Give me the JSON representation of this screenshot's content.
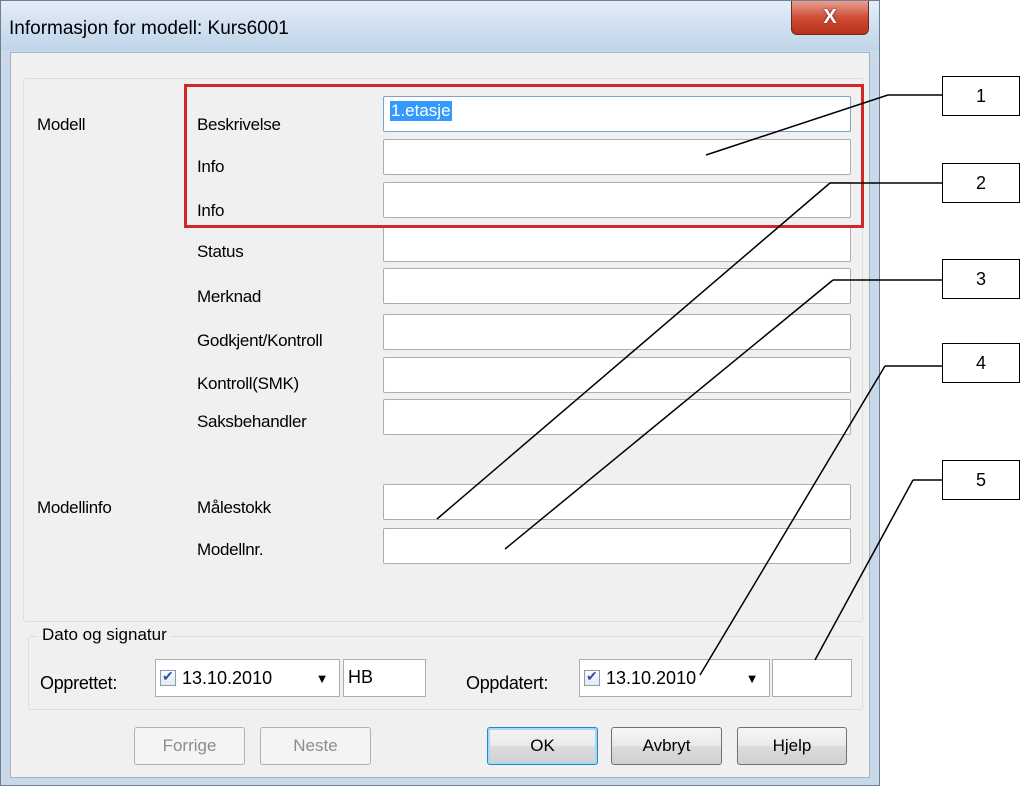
{
  "window": {
    "title": "Informasjon for modell: Kurs6001",
    "close_glyph": "X"
  },
  "sections": {
    "modell": "Modell",
    "modellinfo": "Modellinfo",
    "dato": "Dato og signatur"
  },
  "fields": [
    {
      "label": "Beskrivelse",
      "value": "1.etasje"
    },
    {
      "label": "Info",
      "value": ""
    },
    {
      "label": "Info",
      "value": ""
    },
    {
      "label": "Status",
      "value": ""
    },
    {
      "label": "Merknad",
      "value": ""
    },
    {
      "label": "Godkjent/Kontroll",
      "value": ""
    },
    {
      "label": "Kontroll(SMK)",
      "value": ""
    },
    {
      "label": "Saksbehandler",
      "value": ""
    },
    {
      "label": "Målestokk",
      "value": ""
    },
    {
      "label": "Modellnr.",
      "value": ""
    }
  ],
  "dates": {
    "opprettet_label": "Opprettet:",
    "opprettet_date": "13.10.2010",
    "opprettet_checked": true,
    "opprettet_sign": "HB",
    "oppdatert_label": "Oppdatert:",
    "oppdatert_date": "13.10.2010",
    "oppdatert_checked": true,
    "oppdatert_sign": ""
  },
  "buttons": {
    "forrige": "Forrige",
    "neste": "Neste",
    "ok": "OK",
    "avbryt": "Avbryt",
    "hjelp": "Hjelp"
  },
  "callouts": [
    "1",
    "2",
    "3",
    "4",
    "5"
  ],
  "colors": {
    "highlight_box": "#d0282a",
    "selection": "#3399ff"
  }
}
